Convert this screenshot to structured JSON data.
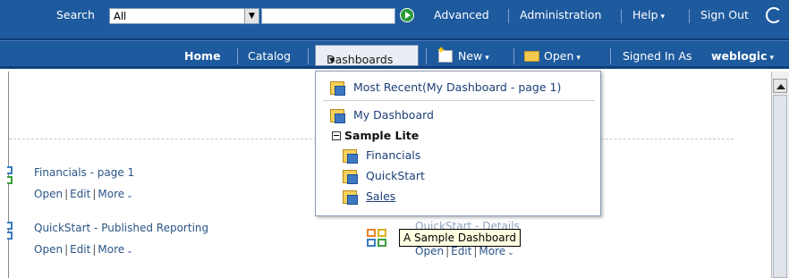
{
  "header": {
    "search_label": "Search",
    "scope_value": "All",
    "search_value": "",
    "advanced": "Advanced",
    "administration": "Administration",
    "help": "Help",
    "sign_out": "Sign Out"
  },
  "nav": {
    "home": "Home",
    "catalog": "Catalog",
    "dashboards": "Dashboards",
    "new": "New",
    "open": "Open",
    "signed_in_as": "Signed In As",
    "username": "weblogic"
  },
  "dashboards_menu": {
    "most_recent": "Most Recent(My Dashboard - page 1)",
    "my_dashboard": "My Dashboard",
    "group": "Sample Lite",
    "items": [
      "Financials",
      "QuickStart",
      "Sales"
    ]
  },
  "content": {
    "items": [
      {
        "title": "Financials - page 1",
        "actions": [
          "Open",
          "Edit",
          "More"
        ]
      },
      {
        "title": "QuickStart - Published Reporting",
        "actions": [
          "Open",
          "Edit",
          "More"
        ]
      },
      {
        "title": "QuickStart - Details",
        "actions": [
          "Open",
          "Edit",
          "More"
        ]
      }
    ],
    "tooltip": "A Sample Dashboard"
  }
}
